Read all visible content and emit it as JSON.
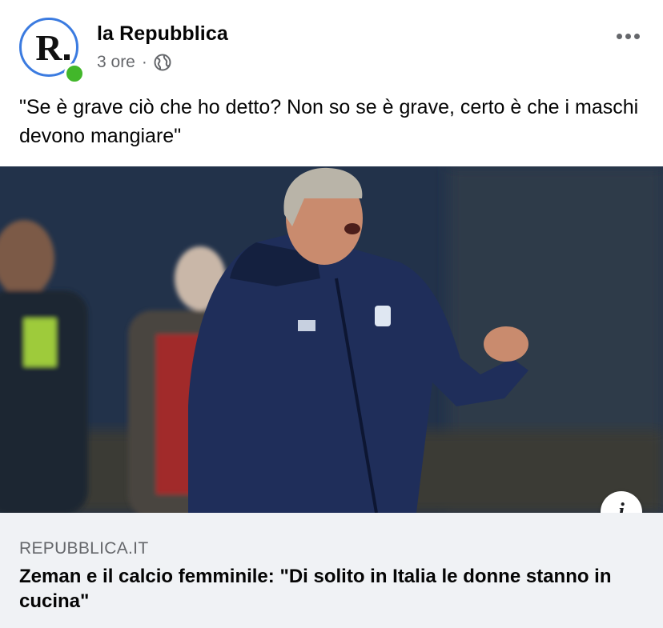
{
  "post": {
    "page_name": "la Repubblica",
    "avatar_letter": "R",
    "timestamp": "3 ore",
    "separator": "·",
    "privacy_icon": "globe-icon",
    "more_icon": "more-options-icon",
    "text": "\"Se è grave ciò che ho detto? Non so se è grave, certo è che i maschi devono mangiare\""
  },
  "link_preview": {
    "image_subject": "coach-photo",
    "info_icon_label": "i",
    "domain": "REPUBBLICA.IT",
    "title": "Zeman e il calcio femminile: \"Di solito in Italia le donne stanno in cucina\""
  },
  "colors": {
    "avatar_ring": "#3b7be0",
    "online": "#42b72a",
    "secondary_text": "#65676b",
    "link_box_bg": "#f0f2f5"
  }
}
